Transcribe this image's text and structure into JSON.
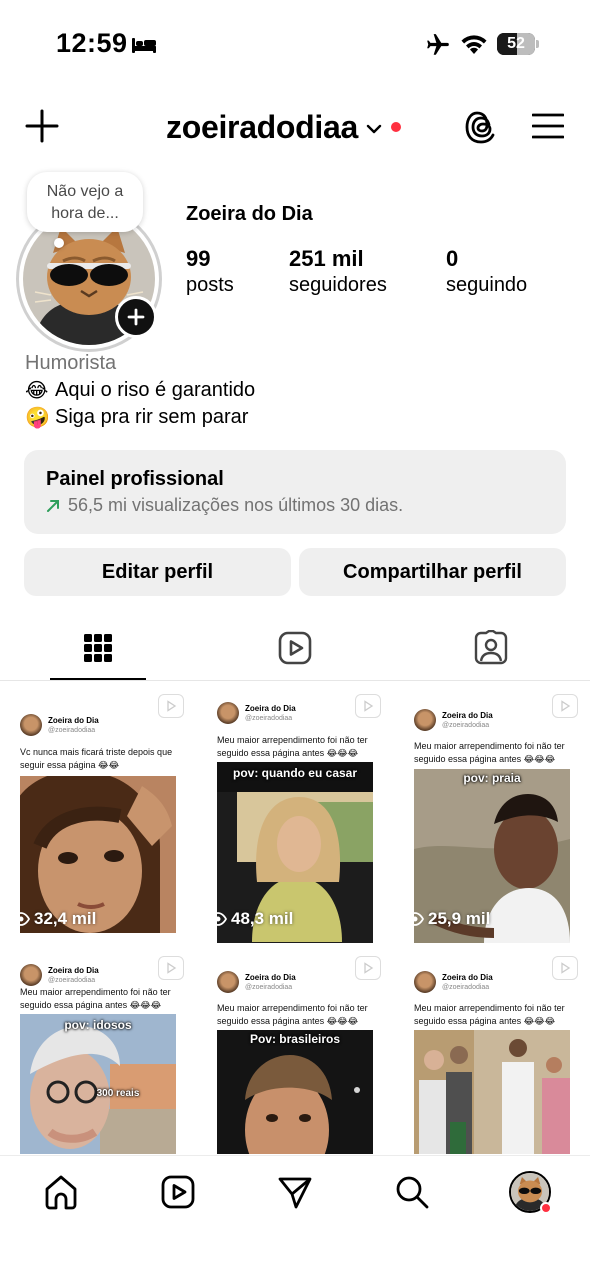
{
  "status_bar": {
    "time": "12:59",
    "battery_level": "52",
    "battery_fraction": 0.52
  },
  "header": {
    "username": "zoeiradodiaa"
  },
  "profile": {
    "note_bubble": "Não vejo a hora de...",
    "display_name": "Zoeira do Dia",
    "stats": [
      {
        "value": "99",
        "label": "posts"
      },
      {
        "value": "251 mil",
        "label": "seguidores"
      },
      {
        "value": "0",
        "label": "seguindo"
      }
    ],
    "category": "Humorista",
    "bio": [
      {
        "emoji": "😂",
        "text": "Aqui o riso é garantido"
      },
      {
        "emoji": "🤪",
        "text": "Siga pra rir sem parar"
      }
    ]
  },
  "dashboard": {
    "title": "Painel profissional",
    "subtitle": "56,5 mi visualizações nos últimos 30 dias."
  },
  "buttons": {
    "edit": "Editar perfil",
    "share": "Compartilhar perfil"
  },
  "tabs": [
    {
      "icon": "grid-icon",
      "active": true
    },
    {
      "icon": "reels-icon",
      "active": false
    },
    {
      "icon": "tagged-icon",
      "active": false
    }
  ],
  "posts": [
    {
      "author": "Zoeira do Dia",
      "handle": "@zoeiradodiaa",
      "caption": "Vc nunca mais ficará triste depois que seguir essa página 😂😂",
      "overlay": "",
      "views": "32,4 mil"
    },
    {
      "author": "Zoeira do Dia",
      "handle": "@zoeiradodiaa",
      "caption": "Meu maior arrependimento foi não ter seguido essa página antes 😂😂😂",
      "overlay": "pov: quando eu casar",
      "views": "48,3 mil"
    },
    {
      "author": "Zoeira do Dia",
      "handle": "@zoeiradodiaa",
      "caption": "Meu maior arrependimento foi não ter seguido essa página antes 😂😂😂",
      "overlay": "pov: praia",
      "views": "25,9 mil"
    },
    {
      "author": "Zoeira do Dia",
      "handle": "@zoeiradodiaa",
      "caption": "Meu maior arrependimento foi não ter seguido essa página antes 😂😂😂",
      "overlay": "pov: idosos",
      "sub_overlay": "300 reais",
      "views": ""
    },
    {
      "author": "Zoeira do Dia",
      "handle": "@zoeiradodiaa",
      "caption": "Meu maior arrependimento foi não ter seguido essa página antes 😂😂😂",
      "overlay": "Pov: brasileiros",
      "views": ""
    },
    {
      "author": "Zoeira do Dia",
      "handle": "@zoeiradodiaa",
      "caption": "Meu maior arrependimento foi não ter seguido essa página antes 😂😂😂",
      "overlay": "",
      "views": ""
    }
  ],
  "bottom_nav": [
    {
      "icon": "home-icon"
    },
    {
      "icon": "reels-icon"
    },
    {
      "icon": "send-icon"
    },
    {
      "icon": "search-icon"
    },
    {
      "icon": "profile-avatar"
    }
  ],
  "colors": {
    "accent_red": "#ff3040",
    "secondary_text": "#737373",
    "button_bg": "#efefef",
    "trend_green": "#2e9e5b"
  }
}
